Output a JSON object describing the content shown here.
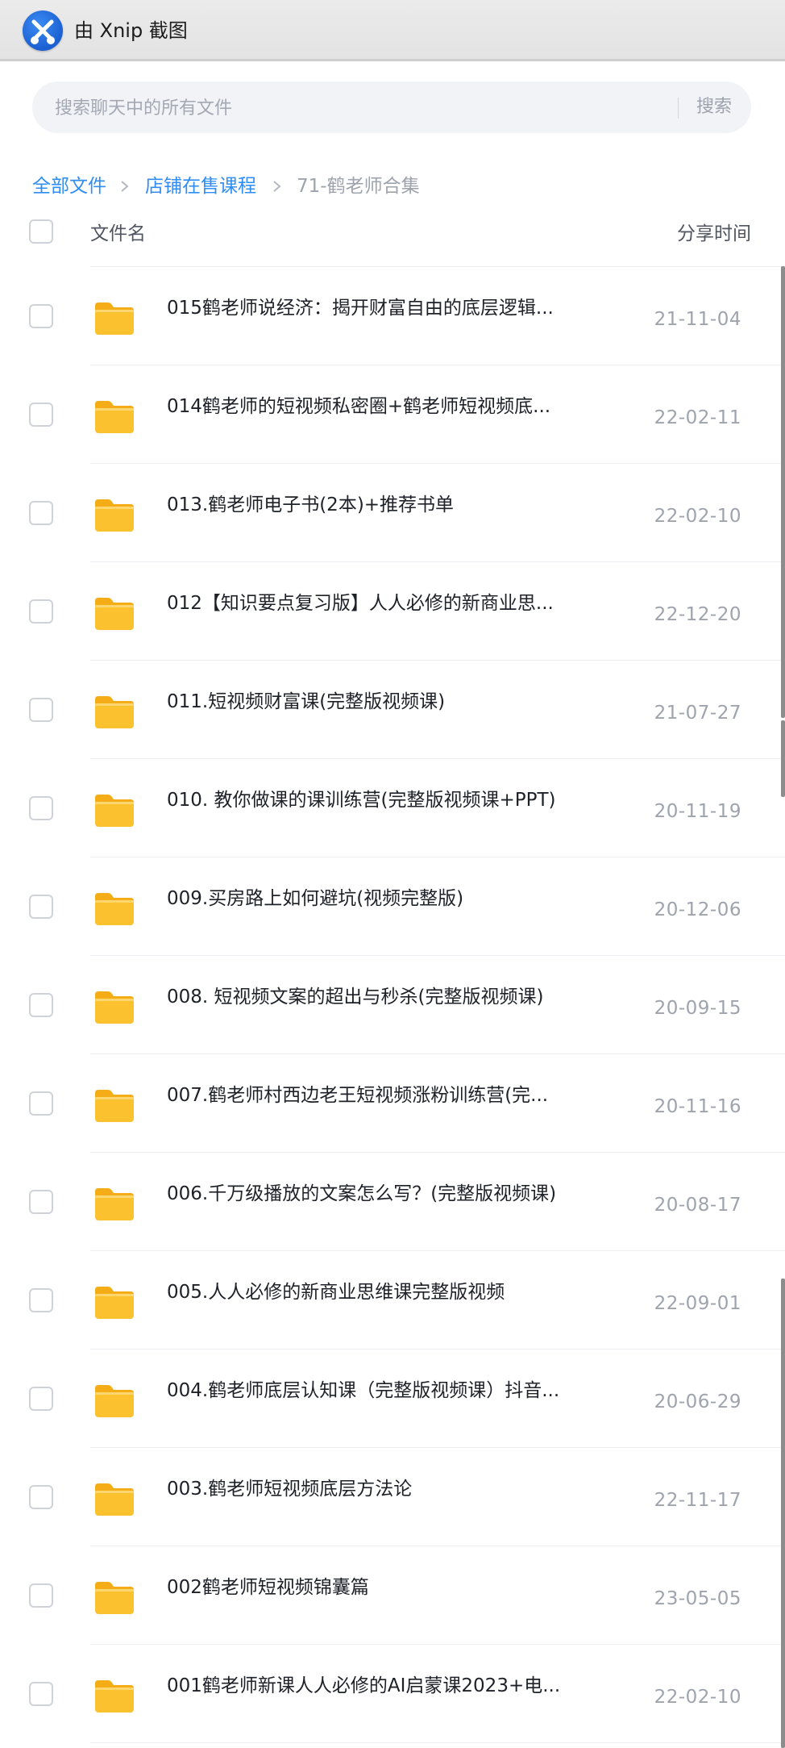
{
  "app": {
    "title": "由 Xnip 截图"
  },
  "search": {
    "placeholder": "搜索聊天中的所有文件",
    "button_label": "搜索"
  },
  "breadcrumb": [
    {
      "label": "全部文件"
    },
    {
      "label": "店铺在售课程"
    },
    {
      "label": "71-鹤老师合集"
    }
  ],
  "table": {
    "header_name": "文件名",
    "header_time": "分享时间",
    "rows": [
      {
        "name": "015鹤老师说经济：揭开财富自由的底层逻辑...",
        "date": "21-11-04"
      },
      {
        "name": "014鹤老师的短视频私密圈+鹤老师短视频底...",
        "date": "22-02-11"
      },
      {
        "name": "013.鹤老师电子书(2本)+推荐书单",
        "date": "22-02-10"
      },
      {
        "name": "012【知识要点复习版】人人必修的新商业思...",
        "date": "22-12-20"
      },
      {
        "name": "011.短视频财富课(完整版视频课)",
        "date": "21-07-27"
      },
      {
        "name": "010. 教你做课的课训练营(完整版视频课+PPT)",
        "date": "20-11-19"
      },
      {
        "name": "009.买房路上如何避坑(视频完整版)",
        "date": "20-12-06"
      },
      {
        "name": "008. 短视频文案的超出与秒杀(完整版视频课)",
        "date": "20-09-15"
      },
      {
        "name": "007.鹤老师村西边老王短视频涨粉训练营(完...",
        "date": "20-11-16"
      },
      {
        "name": "006.千万级播放的文案怎么写？(完整版视频课)",
        "date": "20-08-17"
      },
      {
        "name": "005.人人必修的新商业思维课完整版视频",
        "date": "22-09-01"
      },
      {
        "name": "004.鹤老师底层认知课（完整版视频课）抖音...",
        "date": "20-06-29"
      },
      {
        "name": "003.鹤老师短视频底层方法论",
        "date": "22-11-17"
      },
      {
        "name": "002鹤老师短视频锦囊篇",
        "date": "23-05-05"
      },
      {
        "name": "001鹤老师新课人人必修的AI启蒙课2023+电...",
        "date": "22-02-10"
      }
    ]
  },
  "colors": {
    "accent": "#2f8df3",
    "folder": "#fcc12e",
    "muted_text": "#9ea3ad"
  },
  "icons": {
    "app_logo": "xnip-logo-icon",
    "folder": "folder-icon",
    "breadcrumb_separator": "chevron-right-icon"
  }
}
